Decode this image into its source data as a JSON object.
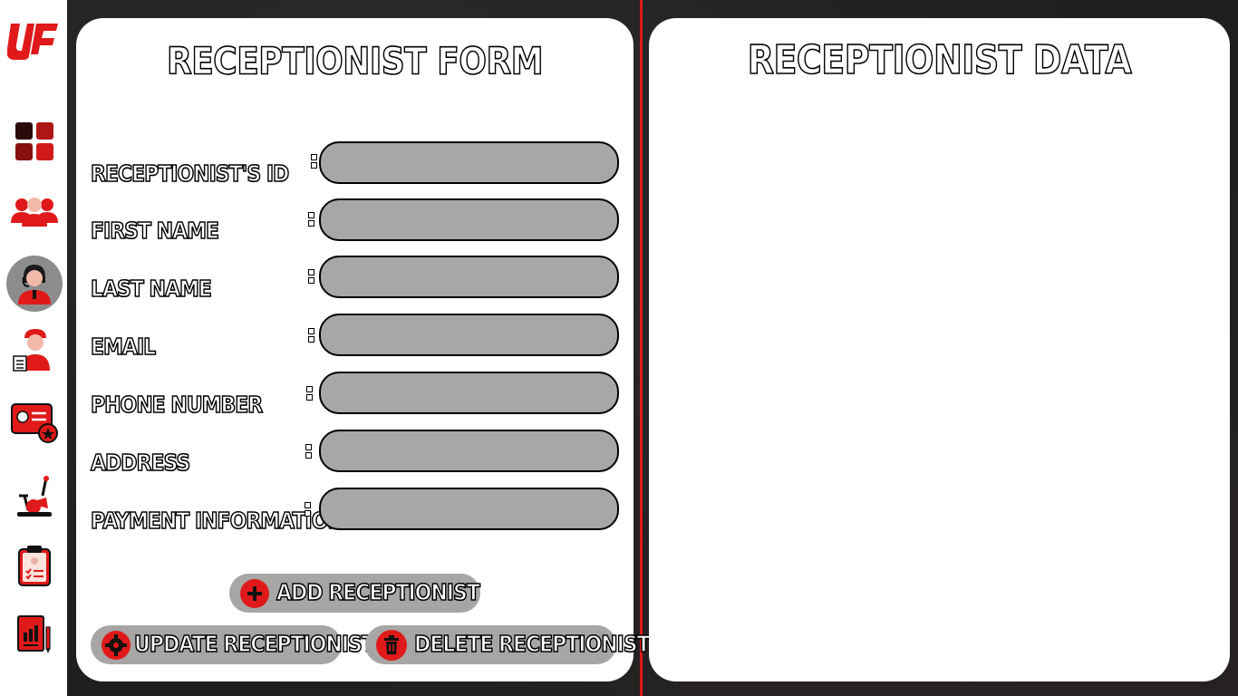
{
  "app": {
    "logo_text": "UF",
    "accent_color": "#e01a1a"
  },
  "sidebar": {
    "items": [
      {
        "name": "dashboard-icon",
        "active": false
      },
      {
        "name": "members-icon",
        "active": false
      },
      {
        "name": "receptionist-icon",
        "active": true
      },
      {
        "name": "trainer-icon",
        "active": false
      },
      {
        "name": "membership-card-icon",
        "active": false
      },
      {
        "name": "equipment-icon",
        "active": false
      },
      {
        "name": "clipboard-icon",
        "active": false
      },
      {
        "name": "report-icon",
        "active": false
      }
    ]
  },
  "form": {
    "title": "RECEPTIONIST FORM",
    "fields": [
      {
        "label": "RECEPTIONIST'S ID",
        "value": "",
        "placeholder": ""
      },
      {
        "label": "FIRST NAME",
        "value": "",
        "placeholder": ""
      },
      {
        "label": "LAST NAME",
        "value": "",
        "placeholder": ""
      },
      {
        "label": "EMAIL",
        "value": "",
        "placeholder": ""
      },
      {
        "label": "PHONE NUMBER",
        "value": "",
        "placeholder": ""
      },
      {
        "label": "ADDRESS",
        "value": "",
        "placeholder": ""
      },
      {
        "label": "PAYMENT INFORMATION",
        "value": "",
        "placeholder": ""
      }
    ],
    "buttons": {
      "add": "ADD RECEPTIONIST",
      "update": "UPDATE RECEPTIONIST",
      "delete": "DELETE RECEPTIONIST"
    }
  },
  "data_panel": {
    "title": "RECEPTIONIST DATA"
  }
}
